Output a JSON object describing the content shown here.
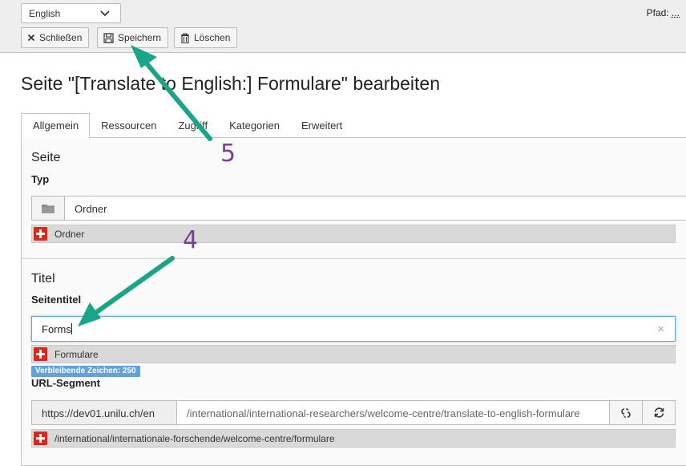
{
  "topbar": {
    "language_selected": "English",
    "path_label": "Pfad:",
    "path_value": "...",
    "buttons": {
      "close_label": "Schließen",
      "save_label": "Speichern",
      "delete_label": "Löschen"
    }
  },
  "page": {
    "heading": "Seite \"[Translate to English:] Formulare\" bearbeiten"
  },
  "tabs": [
    {
      "label": "Allgemein",
      "active": true
    },
    {
      "label": "Ressourcen",
      "active": false
    },
    {
      "label": "Zugriff",
      "active": false
    },
    {
      "label": "Kategorien",
      "active": false
    },
    {
      "label": "Erweitert",
      "active": false
    }
  ],
  "section_seite": {
    "title": "Seite",
    "typ_label": "Typ",
    "typ_value": "Ordner",
    "typ_original": "Ordner"
  },
  "section_titel": {
    "title": "Titel",
    "seitentitel_label": "Seitentitel",
    "seitentitel_value": "Forms",
    "seitentitel_original": "Formulare",
    "remaining_chars": "Verbleibende Zeichen: 250",
    "url_label": "URL-Segment",
    "url_prefix": "https://dev01.unilu.ch/en",
    "url_value": "/international/international-researchers/welcome-centre/translate-to-english-formulare",
    "url_original": "/international/internationale-forschende/welcome-centre/formulare"
  },
  "annotations": {
    "step_save": "5",
    "step_title": "4"
  },
  "colors": {
    "arrow": "#1aa58a",
    "annotation_number": "#7a3f9a",
    "badge": "#5fa2dd",
    "flag": "#d52b1e"
  }
}
